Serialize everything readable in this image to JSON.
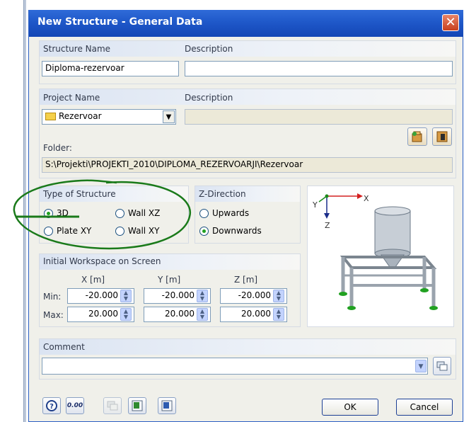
{
  "dialog": {
    "title": "New Structure - General Data",
    "close_glyph": "✕"
  },
  "structure": {
    "name_label": "Structure Name",
    "name_value": "Diploma-rezervoar",
    "desc_label": "Description",
    "desc_value": ""
  },
  "project": {
    "name_label": "Project Name",
    "name_value": "Rezervoar",
    "desc_label": "Description",
    "desc_value": "",
    "folder_label": "Folder:",
    "folder_value": "S:\\Projekti\\PROJEKTI_2010\\DIPLOMA_REZERVOARJI\\Rezervoar"
  },
  "type_of_structure": {
    "label": "Type of Structure",
    "options": [
      "3D",
      "Wall XZ",
      "Plate XY",
      "Wall XY"
    ],
    "selected": "3D"
  },
  "z_direction": {
    "label": "Z-Direction",
    "options": [
      "Upwards",
      "Downwards"
    ],
    "selected": "Downwards"
  },
  "workspace": {
    "label": "Initial Workspace on Screen",
    "columns": [
      "X [m]",
      "Y [m]",
      "Z [m]"
    ],
    "min_label": "Min:",
    "max_label": "Max:",
    "min": [
      "-20.000",
      "-20.000",
      "-20.000"
    ],
    "max": [
      "20.000",
      "20.000",
      "20.000"
    ]
  },
  "preview": {
    "axis_x": "X",
    "axis_y": "Y",
    "axis_z": "Z"
  },
  "comment": {
    "label": "Comment",
    "value": ""
  },
  "buttons": {
    "ok": "OK",
    "cancel": "Cancel",
    "units_icon_text": "0.00"
  },
  "colors": {
    "title_bar": "#1f58c9",
    "annotation": "#1a7a1a",
    "accent": "#21a121"
  }
}
